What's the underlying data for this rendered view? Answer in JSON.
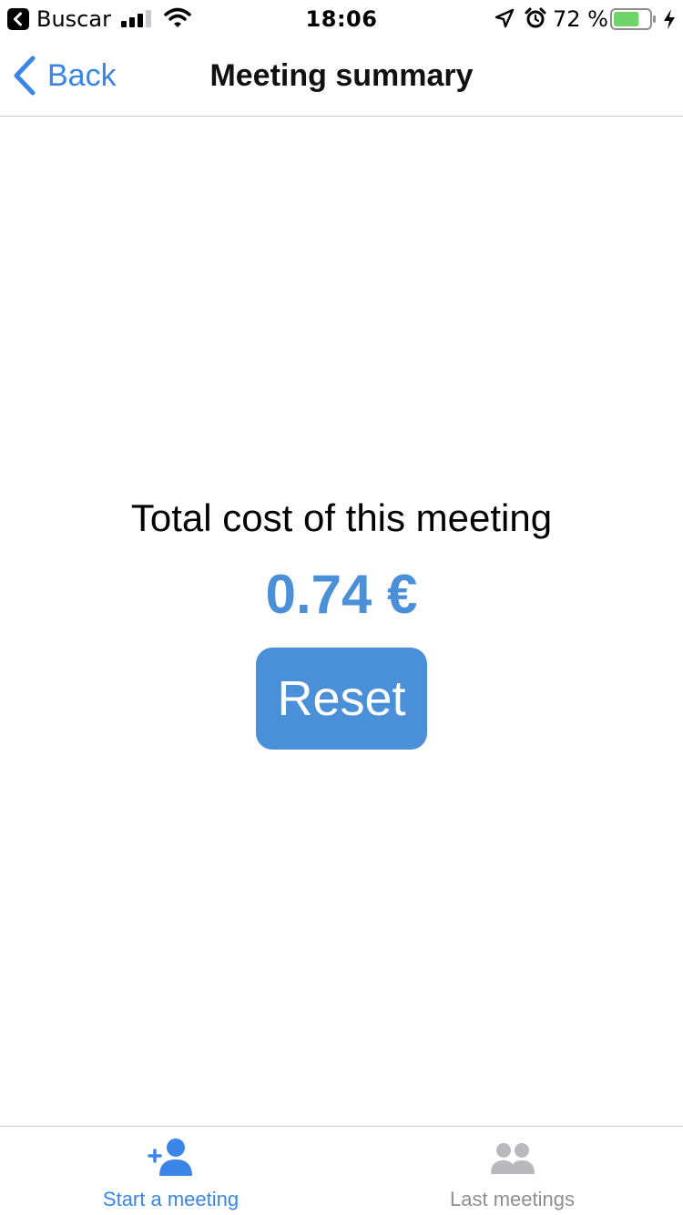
{
  "status_bar": {
    "back_app_label": "Buscar",
    "time": "18:06",
    "battery_percent": "72 %",
    "battery_level": 0.72,
    "icons": [
      "back-app-icon",
      "signal-icon",
      "wifi-icon",
      "location-icon",
      "alarm-icon",
      "battery-icon",
      "charging-icon"
    ]
  },
  "nav": {
    "back_label": "Back",
    "title": "Meeting summary"
  },
  "main": {
    "cost_label": "Total cost of this meeting",
    "cost_value": "0.74 €",
    "reset_label": "Reset"
  },
  "tabs": [
    {
      "label": "Start a meeting",
      "icon": "add-person-icon",
      "active": true
    },
    {
      "label": "Last meetings",
      "icon": "people-icon",
      "active": false
    }
  ],
  "colors": {
    "accent": "#3a86e8",
    "button": "#4a90d9",
    "inactive": "#8e8e93",
    "battery_fill": "#6fd56b"
  }
}
